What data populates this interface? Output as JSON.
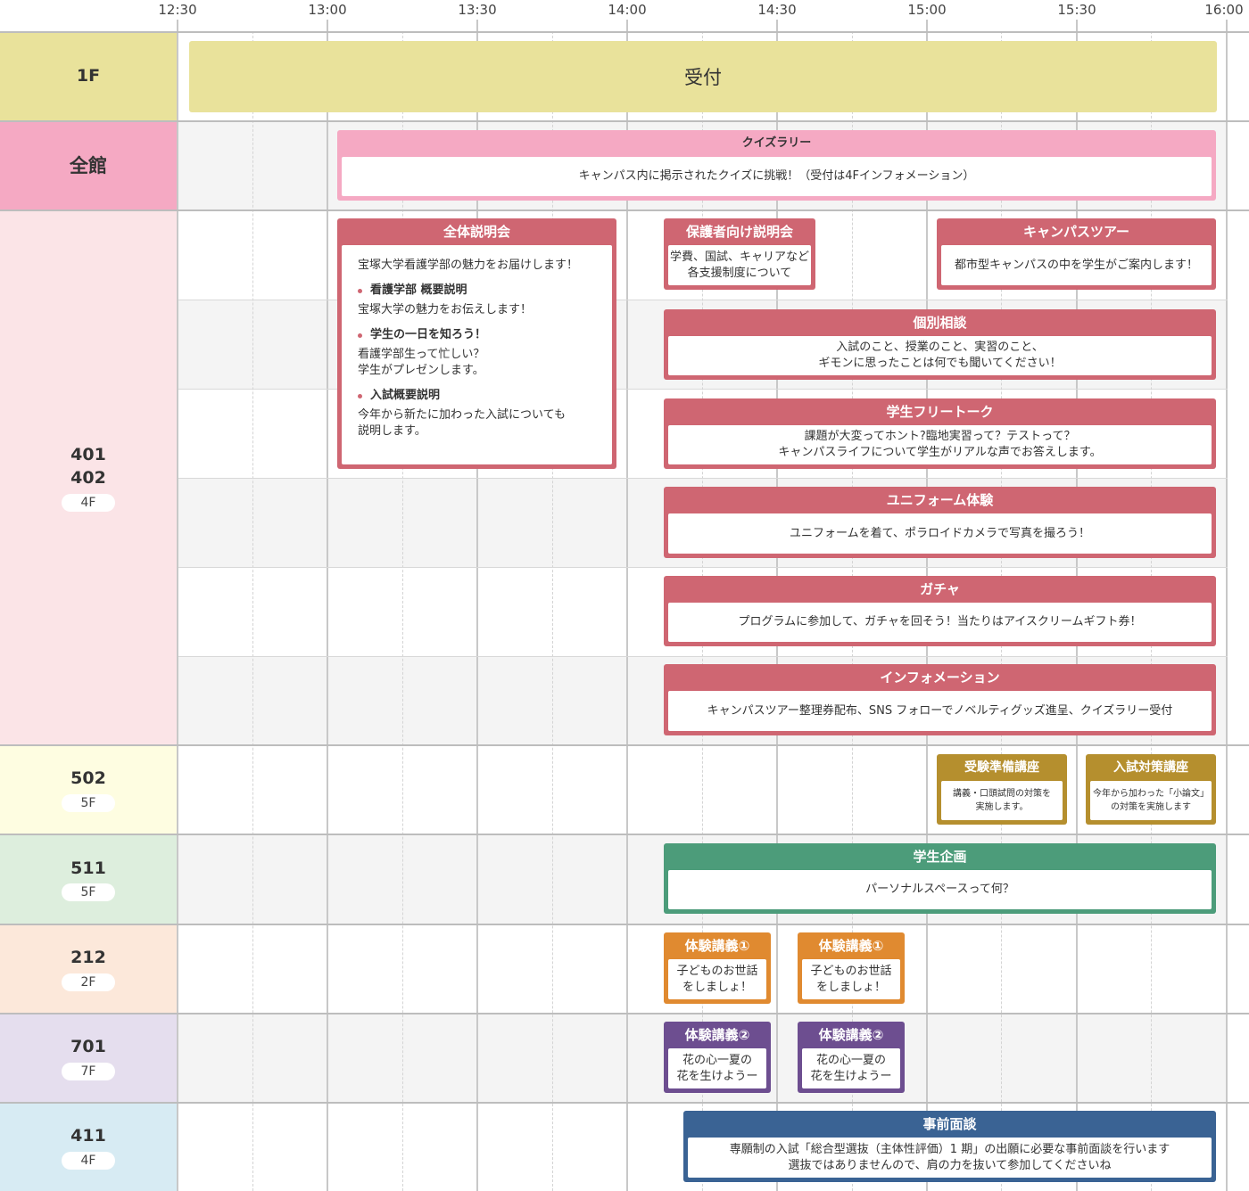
{
  "times": [
    "12:30",
    "13:00",
    "13:30",
    "14:00",
    "14:30",
    "15:00",
    "15:30",
    "16:00"
  ],
  "colors": {
    "row_1f": "#e9e29b",
    "row_all": "#f5a9c3",
    "row_4f": "#fbe4e7",
    "row_502": "#fefde1",
    "row_511": "#ddeedd",
    "row_212": "#fce8da",
    "row_701": "#e5deee",
    "row_411": "#d7ebf3"
  },
  "rooms": {
    "r1f": {
      "name": "1F"
    },
    "rall": {
      "name": "全館"
    },
    "r401": {
      "name": "401\n402",
      "floor": "4F"
    },
    "r502": {
      "name": "502",
      "floor": "5F"
    },
    "r511": {
      "name": "511",
      "floor": "5F"
    },
    "r212": {
      "name": "212",
      "floor": "2F"
    },
    "r701": {
      "name": "701",
      "floor": "7F"
    },
    "r411": {
      "name": "411",
      "floor": "4F"
    }
  },
  "events": {
    "reception": {
      "title": "受付"
    },
    "quiz": {
      "title": "クイズラリー",
      "body": "キャンパス内に掲示されたクイズに挑戦！（受付は4Fインフォメーション）"
    },
    "intro": {
      "title": "全体説明会",
      "lead": "宝塚大学看護学部の魅力をお届けします！",
      "items": [
        {
          "heading": "看護学部 概要説明",
          "desc": "宝塚大学の魅力をお伝えします！"
        },
        {
          "heading": "学生の一日を知ろう！",
          "desc": "看護学部生って忙しい？\n学生がプレゼンします。"
        },
        {
          "heading": "入試概要説明",
          "desc": "今年から新たに加わった入試についても\n説明します。"
        }
      ]
    },
    "parents": {
      "title": "保護者向け説明会",
      "body": "学費、国試、キャリアなど\n各支援制度について"
    },
    "tour": {
      "title": "キャンパスツアー",
      "body": "都市型キャンパスの中を学生がご案内します！"
    },
    "consult": {
      "title": "個別相談",
      "body": "入試のこと、授業のこと、実習のこと、\nギモンに思ったことは何でも聞いてください！"
    },
    "freetalk": {
      "title": "学生フリートーク",
      "body": "課題が大変ってホント?臨地実習って？テストって？\nキャンパスライフについて学生がリアルな声でお答えします。"
    },
    "uniform": {
      "title": "ユニフォーム体験",
      "body": "ユニフォームを着て、ポラロイドカメラで写真を撮ろう！"
    },
    "gacha": {
      "title": "ガチャ",
      "body": "プログラムに参加して、ガチャを回そう！当たりはアイスクリームギフト券！"
    },
    "info": {
      "title": "インフォメーション",
      "body": "キャンパスツアー整理券配布、SNS フォローでノベルティグッズ進呈、クイズラリー受付"
    },
    "prep": {
      "title": "受験準備講座",
      "body": "講義・口頭試問の対策を\n実施します。"
    },
    "exam": {
      "title": "入試対策講座",
      "body": "今年から加わった「小論文」\nの対策を実施します"
    },
    "student": {
      "title": "学生企画",
      "body": "パーソナルスペースって何？"
    },
    "lecture1a": {
      "title": "体験講義①",
      "body": "子どものお世話\nをしましょ！"
    },
    "lecture1b": {
      "title": "体験講義①",
      "body": "子どものお世話\nをしましょ！"
    },
    "lecture2a": {
      "title": "体験講義②",
      "body": "花の心一夏の\n花を生けようー"
    },
    "lecture2b": {
      "title": "体験講義②",
      "body": "花の心一夏の\n花を生けようー"
    },
    "interview": {
      "title": "事前面談",
      "body": "専願制の入試「総合型選抜（主体性評価）1 期」の出願に必要な事前面談を行います\n選抜ではありませんので、肩の力を抜いて参加してくださいね"
    }
  }
}
